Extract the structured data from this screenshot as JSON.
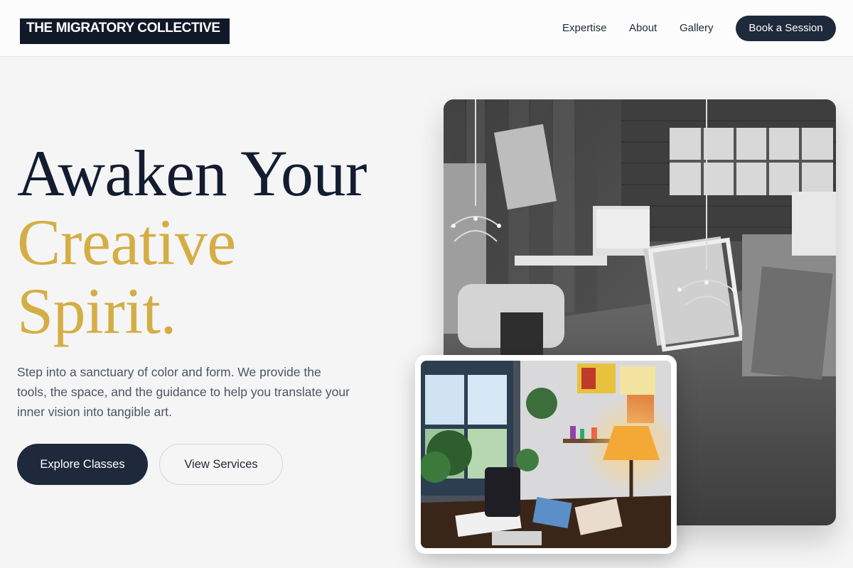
{
  "brand": {
    "name": "THE MIGRATORY COLLECTIVE"
  },
  "nav": {
    "links": [
      "Expertise",
      "About",
      "Gallery"
    ],
    "cta": "Book a Session"
  },
  "hero": {
    "title_line1": "Awaken Your",
    "title_line2": "Creative",
    "title_line3": "Spirit.",
    "subtitle": "Step into a sanctuary of color and form. We provide the tools, the space, and the guidance to help you translate your inner vision into tangible art.",
    "primary_button": "Explore Classes",
    "secondary_button": "View Services"
  },
  "images": {
    "main_photo": "black-and-white art studio with canvases and chandeliers",
    "inset_photo": "colorful studio desk with plants, lamp and sketchbooks"
  },
  "colors": {
    "navy": "#1e293b",
    "gold": "#d4ae45",
    "background": "#f5f5f5"
  }
}
